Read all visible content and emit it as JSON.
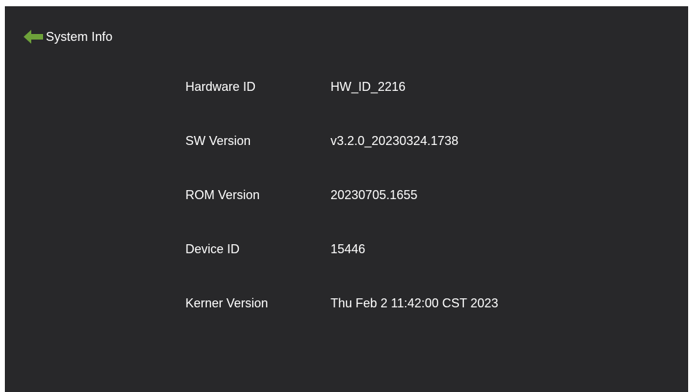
{
  "header": {
    "title": "System Info",
    "back_icon": "arrow-left-icon",
    "back_icon_color": "#6ea23a"
  },
  "info": [
    {
      "label": "Hardware ID",
      "value": "HW_ID_2216"
    },
    {
      "label": "SW Version",
      "value": "v3.2.0_20230324.1738"
    },
    {
      "label": "ROM Version",
      "value": "20230705.1655"
    },
    {
      "label": "Device ID",
      "value": "15446"
    },
    {
      "label": "Kerner Version",
      "value": "Thu Feb 2 11:42:00 CST 2023"
    }
  ],
  "colors": {
    "background": "#28282a",
    "text": "#ffffff"
  }
}
